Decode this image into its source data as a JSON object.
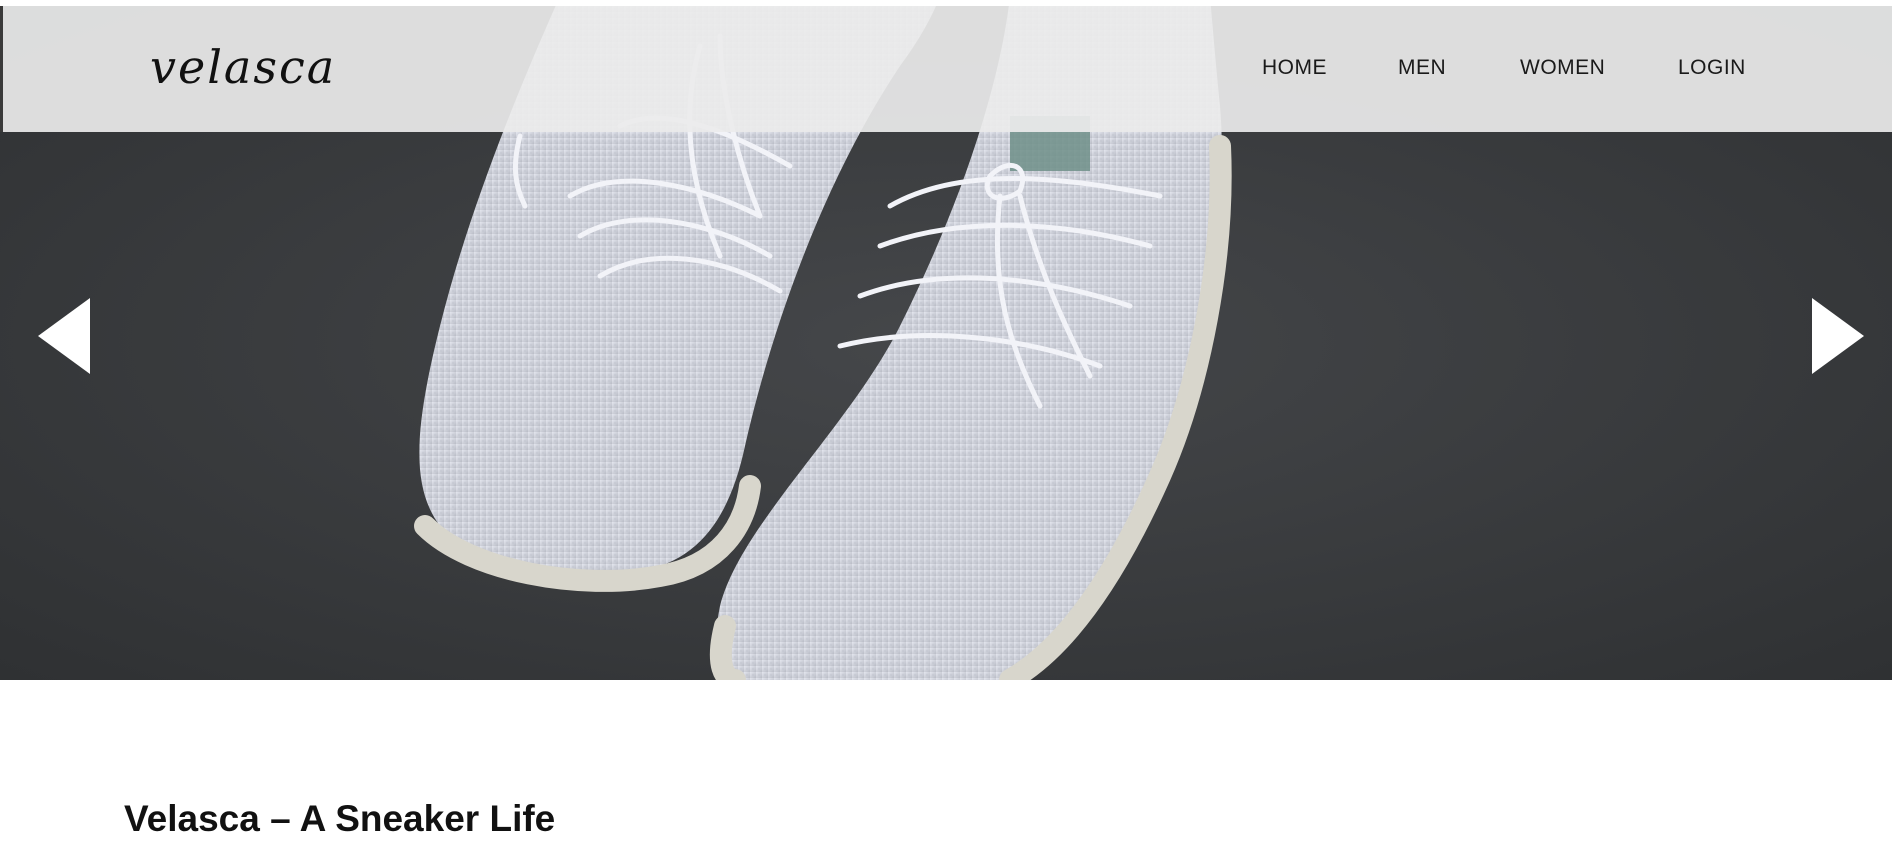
{
  "brand": {
    "logo_text": "velasca"
  },
  "nav": {
    "items": [
      "HOME",
      "MEN",
      "WOMEN",
      "LOGIN"
    ]
  },
  "carousel": {
    "prev_icon": "triangle-left-icon",
    "next_icon": "triangle-right-icon",
    "slide_image": "white knit sneakers on dark background"
  },
  "content": {
    "title": "Velasca – A Sneaker Life"
  },
  "colors": {
    "navbar_bg": "#ececec",
    "hero_bg": "#3a3c3e",
    "text": "#111111",
    "arrow": "#ffffff"
  }
}
